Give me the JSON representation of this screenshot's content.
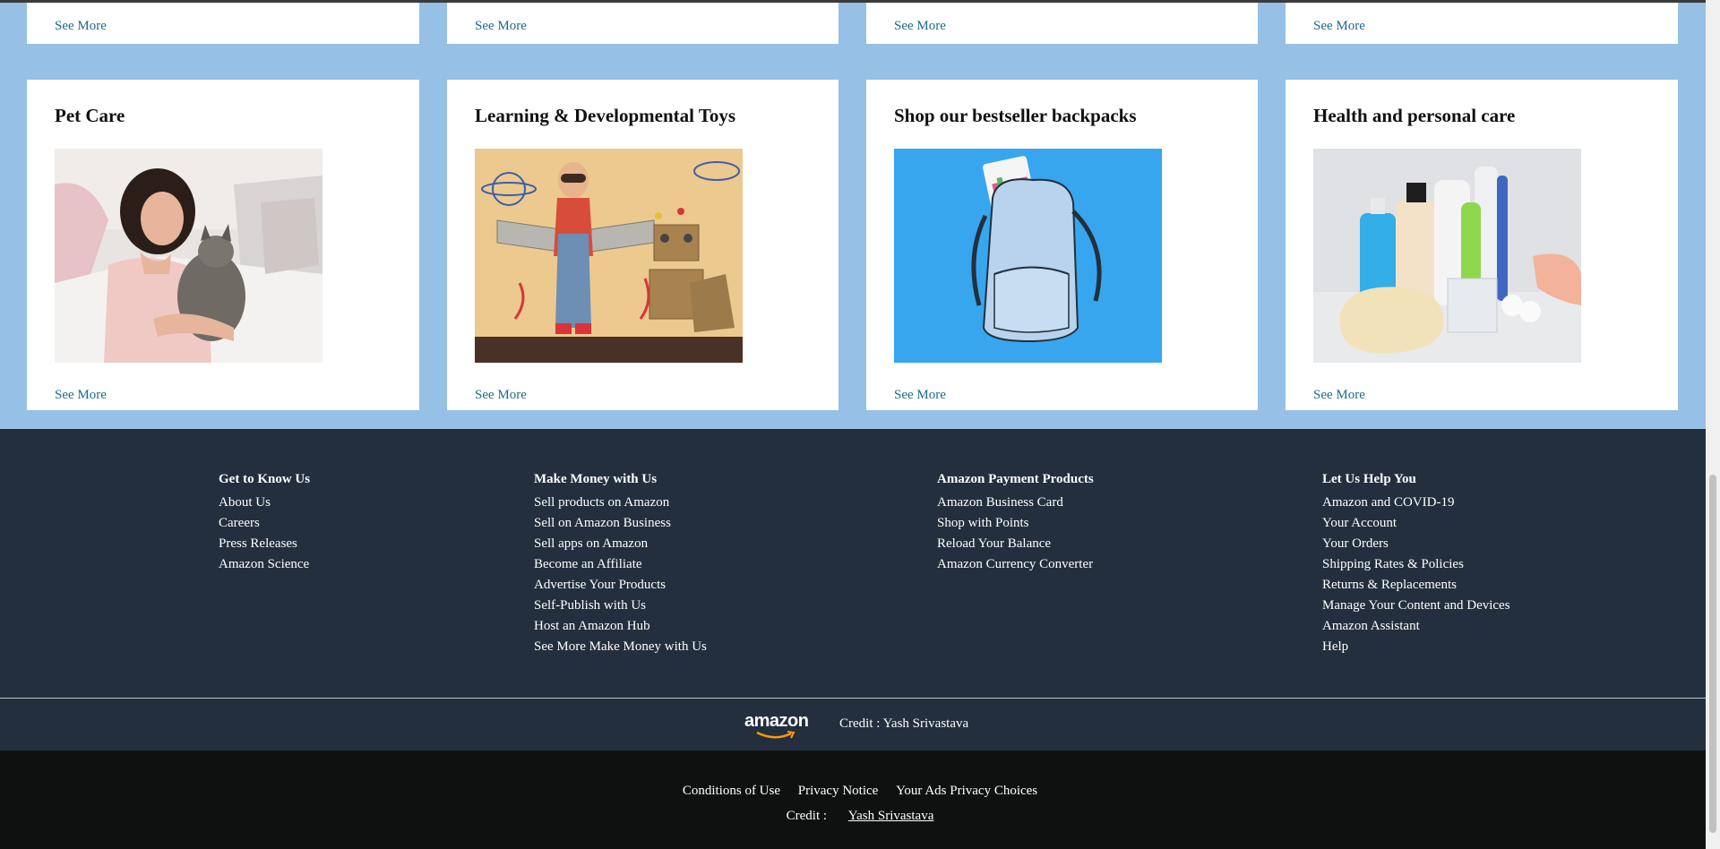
{
  "top_row": {
    "see_more": [
      "See More",
      "See More",
      "See More",
      "See More"
    ]
  },
  "cards": [
    {
      "title": "Pet Care",
      "see_more": "See More"
    },
    {
      "title": "Learning & Developmental Toys",
      "see_more": "See More"
    },
    {
      "title": "Shop our bestseller backpacks",
      "see_more": "See More"
    },
    {
      "title": "Health and personal care",
      "see_more": "See More"
    }
  ],
  "footer": {
    "columns": [
      {
        "heading": "Get to Know Us",
        "links": [
          "About Us",
          "Careers",
          "Press Releases",
          "Amazon Science"
        ]
      },
      {
        "heading": "Make Money with Us",
        "links": [
          "Sell products on Amazon",
          "Sell on Amazon Business",
          "Sell apps on Amazon",
          "Become an Affiliate",
          "Advertise Your Products",
          "Self-Publish with Us",
          "Host an Amazon Hub",
          "See More Make Money with Us"
        ]
      },
      {
        "heading": "Amazon Payment Products",
        "links": [
          "Amazon Business Card",
          "Shop with Points",
          "Reload Your Balance",
          "Amazon Currency Converter"
        ]
      },
      {
        "heading": "Let Us Help You",
        "links": [
          "Amazon and COVID-19",
          "Your Account",
          "Your Orders",
          "Shipping Rates & Policies",
          "Returns & Replacements",
          "Manage Your Content and Devices",
          "Amazon Assistant",
          "Help"
        ]
      }
    ],
    "logo_text": "amazon",
    "credit": "Credit : Yash Srivastava"
  },
  "bottom": {
    "links": [
      "Conditions of Use",
      "Privacy Notice",
      "Your Ads Privacy Choices"
    ],
    "credit_label": "Credit :",
    "credit_name": "Yash Srivastava"
  }
}
